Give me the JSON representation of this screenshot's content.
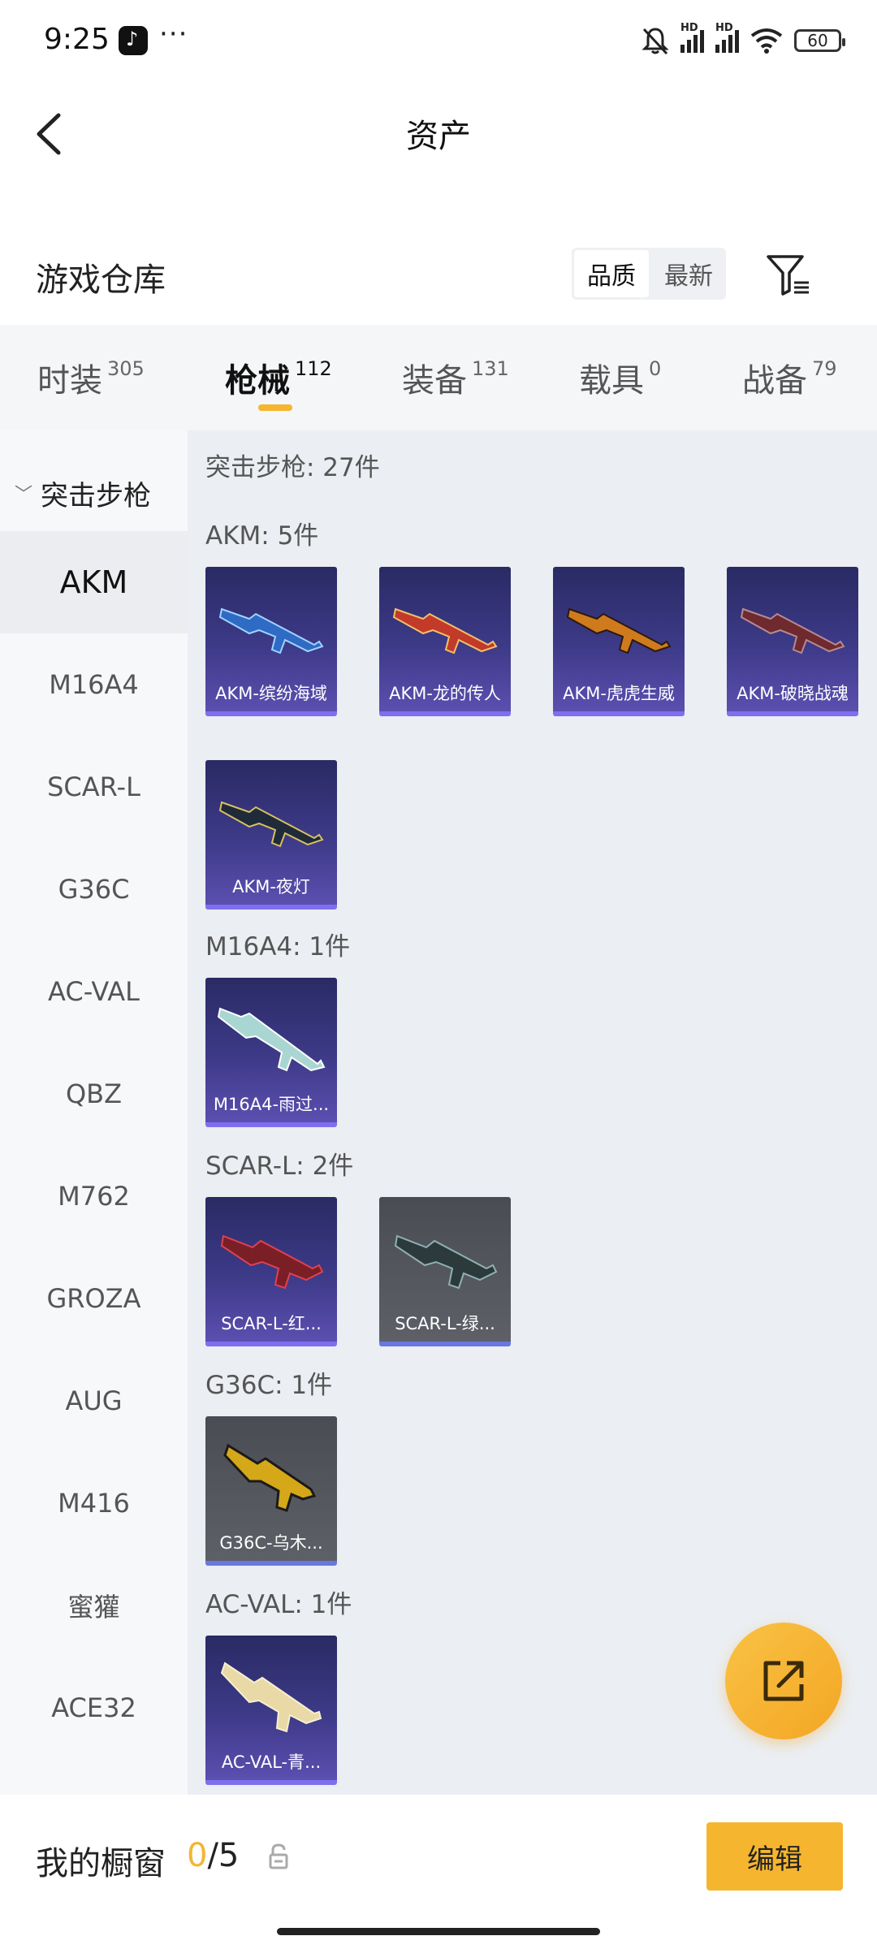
{
  "status": {
    "time": "9:25",
    "battery": "60",
    "more": "···",
    "hd1": "HD",
    "hd2": "HD"
  },
  "header": {
    "title": "资产"
  },
  "section": {
    "title": "游戏仓库",
    "sort": [
      "品质",
      "最新"
    ]
  },
  "tabs": [
    {
      "label": "时装",
      "count": "305"
    },
    {
      "label": "枪械",
      "count": "112",
      "active": true
    },
    {
      "label": "装备",
      "count": "131"
    },
    {
      "label": "载具",
      "count": "0"
    },
    {
      "label": "战备",
      "count": "79"
    }
  ],
  "sidebar": {
    "group": "突击步枪",
    "items": [
      "AKM",
      "M16A4",
      "SCAR-L",
      "G36C",
      "AC-VAL",
      "QBZ",
      "M762",
      "GROZA",
      "AUG",
      "M416",
      "蜜獾",
      "ACE32"
    ]
  },
  "main": {
    "total_label": "突击步枪: 27件",
    "groups": [
      {
        "label": "AKM: 5件",
        "items": [
          "AKM-缤纷海域",
          "AKM-龙的传人",
          "AKM-虎虎生威",
          "AKM-破晓战魂",
          "AKM-夜灯"
        ]
      },
      {
        "label": "M16A4: 1件",
        "items": [
          "M16A4-雨过..."
        ]
      },
      {
        "label": "SCAR-L: 2件",
        "items": [
          "SCAR-L-红...",
          "SCAR-L-绿..."
        ]
      },
      {
        "label": "G36C: 1件",
        "items": [
          "G36C-乌木..."
        ]
      },
      {
        "label": "AC-VAL: 1件",
        "items": [
          "AC-VAL-青..."
        ]
      }
    ]
  },
  "bottom": {
    "label": "我的橱窗",
    "current": "0",
    "total": "/5",
    "edit_label": "编辑"
  },
  "colors": {
    "accent": "#f5b52e",
    "card_purple": "#3d3a88",
    "card_grey": "#56585f"
  }
}
